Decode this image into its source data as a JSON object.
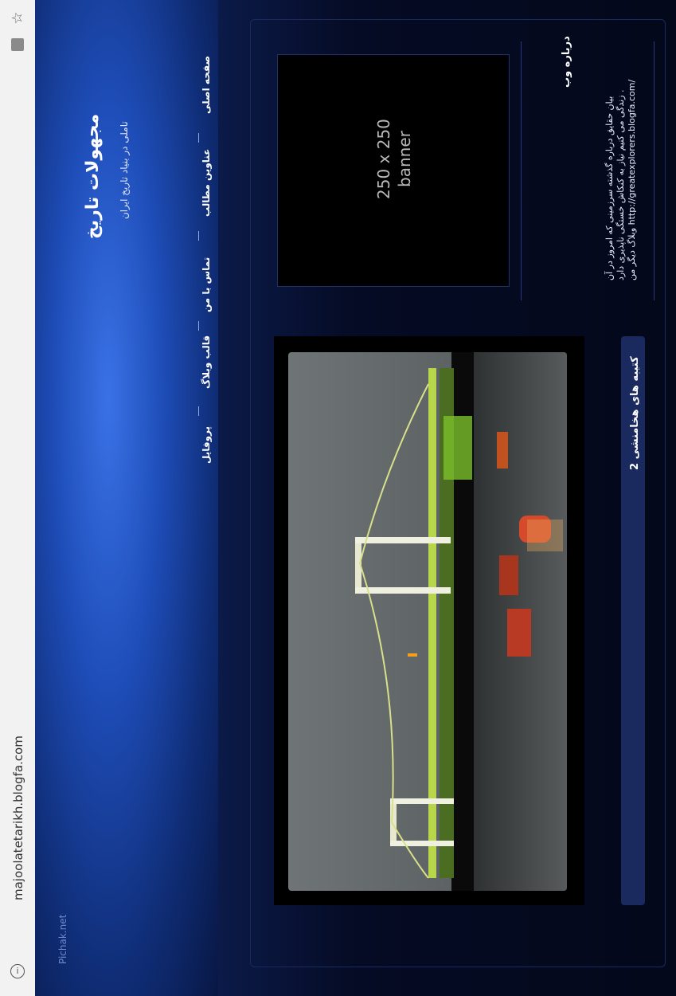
{
  "browser": {
    "url": "majoolatetarikh.blogfa.com",
    "info_icon": "i"
  },
  "site": {
    "title": "مجهولات تاریخ",
    "subtitle": "تاملی در بنیاد تاریخ ایران",
    "footer_brand": "Pichak.net"
  },
  "nav": {
    "items": [
      "صفحه اصلی",
      "عناوین مطالب",
      "تماس با من",
      "قالب وبلاگ",
      "پروفایل"
    ]
  },
  "sidebar": {
    "banner_line1": "250 x 250",
    "banner_line2": "banner",
    "about_title": "درباره وب",
    "about_line1": "بیان حقایق درباره گذشته سرزمینی که امروز در آن",
    "about_line2": "زندگی می کنیم نیاز به کنکاش خستگی ناپذیری دارد .",
    "about_line3": "وبلاگ دیگر من http://greatexplorers.blogfa.com/"
  },
  "post": {
    "title": "کتیبه های هخامنشی 2"
  },
  "icons": {
    "star": "star-icon",
    "extension": "extension-icon",
    "info": "info-icon"
  }
}
